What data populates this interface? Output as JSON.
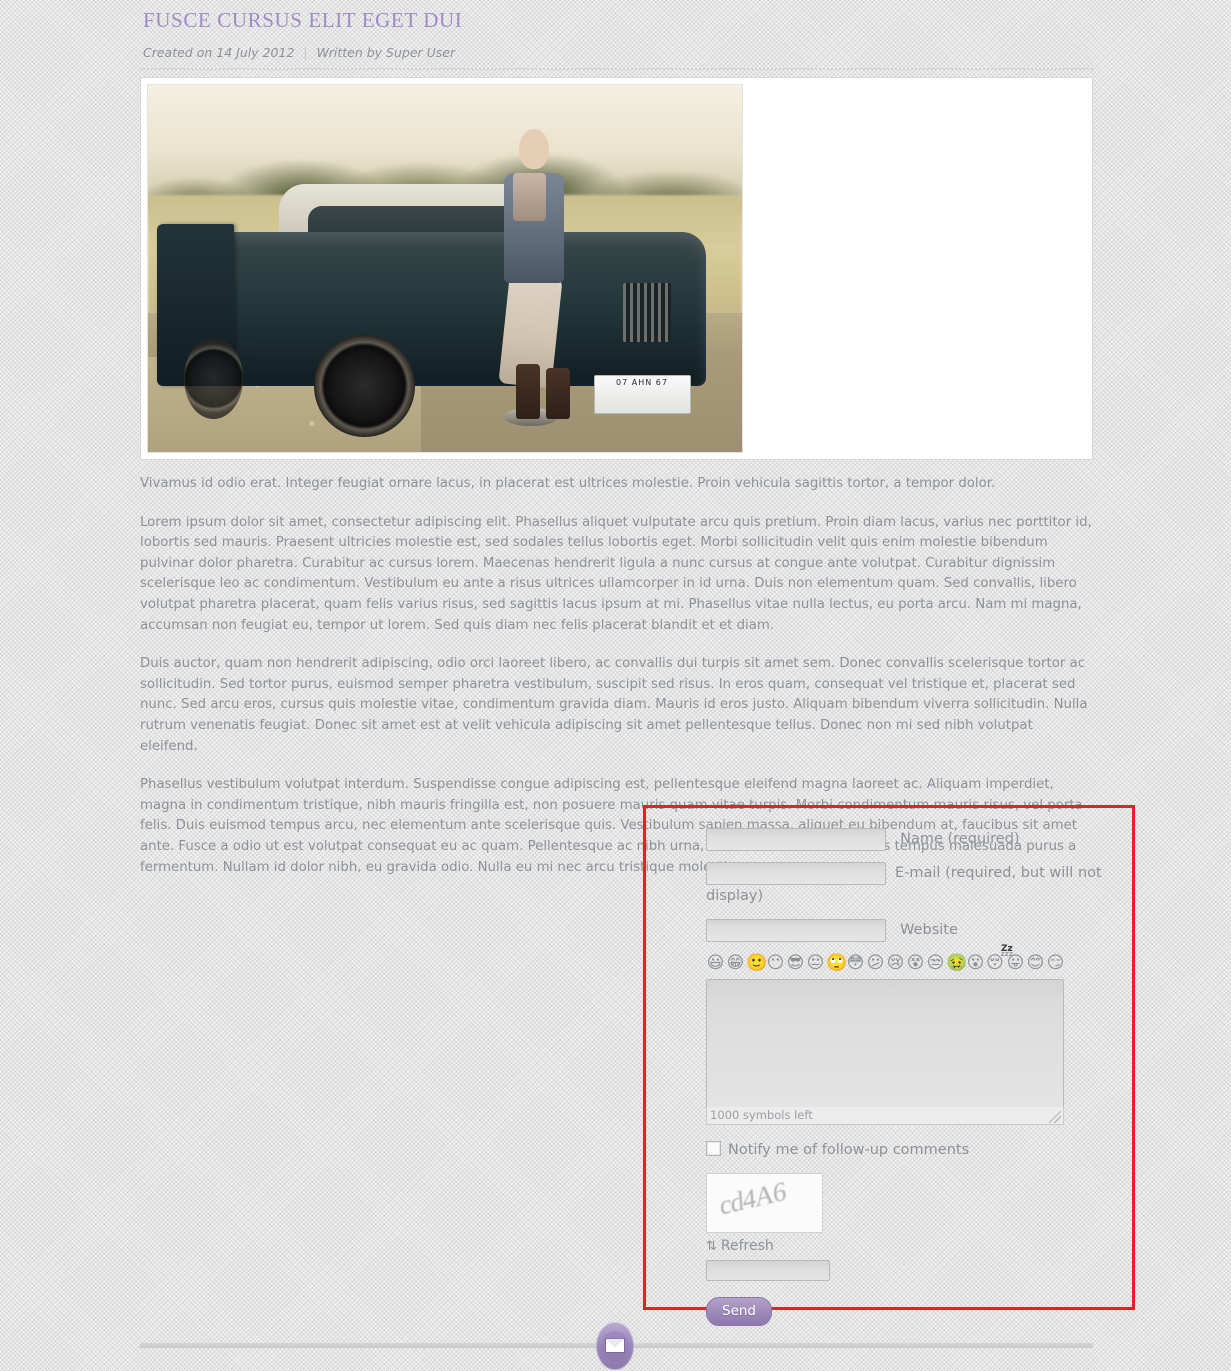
{
  "article": {
    "title": "FUSCE CURSUS ELIT EGET DUI",
    "created_label": "Created on 14 July 2012",
    "separator": "|",
    "author_label": "Written by Super User",
    "image_alt": "Woman sitting on the trunk of a vintage dark green Ford Mustang in a dry field",
    "license_plate": "07  AHN  67",
    "paragraphs": [
      "Vivamus id odio erat. Integer feugiat ornare lacus, in placerat est ultrices molestie. Proin vehicula sagittis tortor, a tempor dolor.",
      "Lorem ipsum dolor sit amet, consectetur adipiscing elit. Phasellus aliquet vulputate arcu quis pretium. Proin diam lacus, varius nec porttitor id, lobortis sed mauris. Praesent ultricies molestie est, sed sodales tellus lobortis eget. Morbi sollicitudin velit quis enim molestie bibendum pulvinar dolor pharetra. Curabitur ac cursus lorem. Maecenas hendrerit ligula a nunc cursus at congue ante volutpat. Curabitur dignissim scelerisque leo ac condimentum. Vestibulum eu ante a risus ultrices ullamcorper in id urna. Duis non elementum quam. Sed convallis, libero volutpat pharetra placerat, quam felis varius risus, sed sagittis lacus ipsum at mi. Phasellus vitae nulla lectus, eu porta arcu. Nam mi magna, accumsan non feugiat eu, tempor ut lorem. Sed quis diam nec felis placerat blandit et et diam.",
      "Duis auctor, quam non hendrerit adipiscing, odio orci laoreet libero, ac convallis dui turpis sit amet sem. Donec convallis scelerisque tortor ac sollicitudin. Sed tortor purus, euismod semper pharetra vestibulum, suscipit sed risus. In eros quam, consequat vel tristique et, placerat sed nunc. Sed arcu eros, cursus quis molestie vitae, condimentum gravida diam. Mauris id eros justo. Aliquam bibendum viverra sollicitudin. Nulla rutrum venenatis feugiat. Donec sit amet est at velit vehicula adipiscing sit amet pellentesque tellus. Donec non mi sed nibh volutpat eleifend.",
      "Phasellus vestibulum volutpat interdum. Suspendisse congue adipiscing est, pellentesque eleifend magna laoreet ac. Aliquam imperdiet, magna in condimentum tristique, nibh mauris fringilla est, non posuere mauris quam vitae turpis. Morbi condimentum mauris risus, vel porta felis. Duis euismod tempus arcu, nec elementum ante scelerisque quis. Vestibulum sapien massa, aliquet eu bibendum at, faucibus sit amet ante. Fusce a odio ut est volutpat consequat eu ac quam. Pellentesque ac nibh urna, ut commodo eros. Vivamus tempus malesuada purus a fermentum. Nullam id dolor nibh, eu gravida odio. Nulla eu mi nec arcu tristique molestie."
    ]
  },
  "comment_form": {
    "name": {
      "value": "",
      "placeholder": "",
      "label": "Name (required)"
    },
    "email": {
      "value": "",
      "placeholder": "",
      "label": "E-mail (required, but will not display)"
    },
    "website": {
      "value": "",
      "placeholder": "",
      "label": "Website"
    },
    "emoticons": [
      "😃",
      "😁",
      "🙂",
      "😶",
      "😎",
      "😐",
      "🙄",
      "😳",
      "😕",
      "😢",
      "😵",
      "😒",
      "🤢",
      "😮",
      "😴",
      "😛",
      "😊",
      "😏"
    ],
    "emoticon_names": [
      "grin-emoticon",
      "laugh-emoticon",
      "smile-emoticon",
      "neutral-smile-emoticon",
      "cool-emoticon",
      "straight-face-emoticon",
      "roll-eyes-emoticon",
      "blush-emoticon",
      "frown-emoticon",
      "cry-emoticon",
      "dizzy-emoticon",
      "annoyed-emoticon",
      "sick-emoticon",
      "surprised-emoticon",
      "sleeping-emoticon",
      "tongue-emoticon",
      "happy-emoticon",
      "smirk-emoticon"
    ],
    "sleep_marker": "Zz",
    "comment": {
      "value": "",
      "placeholder": ""
    },
    "counter_text": "1000 symbols left",
    "notify_label": "Notify me of follow-up comments",
    "notify_checked": false,
    "captcha_text": "cd4A6",
    "refresh_label": "Refresh",
    "refresh_icon": "⇅",
    "captcha_input": {
      "value": "",
      "placeholder": ""
    },
    "send_label": "Send",
    "highlight_color": "#ee1c23"
  },
  "footer": {
    "icon_name": "envelope-icon"
  },
  "theme": {
    "title_color": "#a08cc4",
    "text_color": "#8d9299",
    "accent_color": "#9a86ba",
    "background_color": "#f1f1f1"
  }
}
